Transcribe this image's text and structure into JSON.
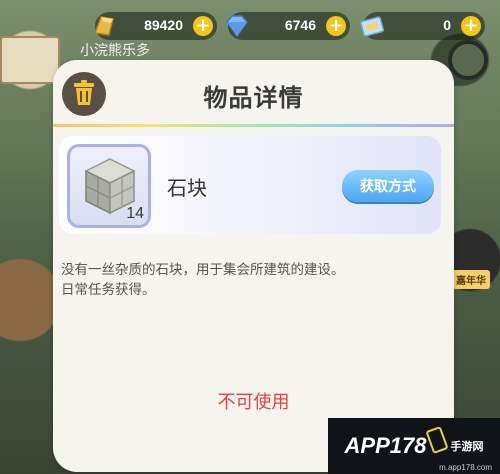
{
  "currencies": [
    {
      "icon": "gold-bar-icon",
      "value": "89420"
    },
    {
      "icon": "diamond-icon",
      "value": "6746"
    },
    {
      "icon": "ticket-icon",
      "value": "0"
    }
  ],
  "background": {
    "text": "小浣熊乐多",
    "tag": "嘉年华"
  },
  "panel": {
    "title": "物品详情",
    "item": {
      "name": "石块",
      "quantity": "14",
      "obtain_button": "获取方式"
    },
    "description": [
      "没有一丝杂质的石块，用于集会所建筑的建设。",
      "日常任务获得。"
    ],
    "status": "不可使用"
  },
  "watermark": {
    "main": "APP178",
    "sub": "手游网",
    "url": "m.app178.com"
  },
  "colors": {
    "gold_plus": "#f5c518",
    "button_blue": "#4da6ef",
    "unusable_red": "#e0433f",
    "trash_button": "#5a4f46"
  }
}
